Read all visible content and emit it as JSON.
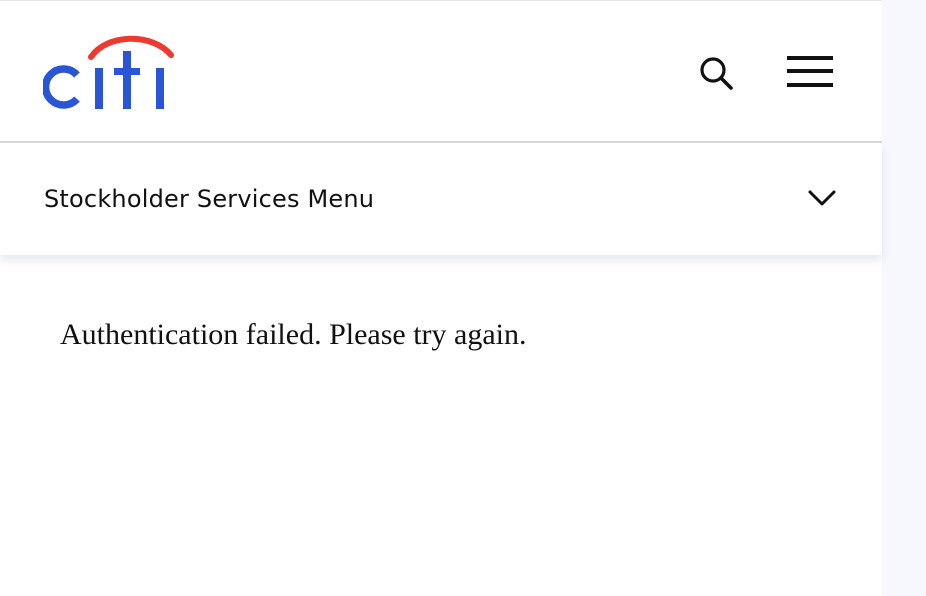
{
  "brand": {
    "logo_text": "citi",
    "logo_color": "#2a56d6",
    "arc_color": "#ee3a2e"
  },
  "header": {
    "search_icon": "search-icon",
    "menu_icon": "hamburger-menu-icon"
  },
  "submenu": {
    "label": "Stockholder Services Menu",
    "toggle_icon": "chevron-down-icon"
  },
  "main": {
    "message": "Authentication failed. Please try again."
  }
}
